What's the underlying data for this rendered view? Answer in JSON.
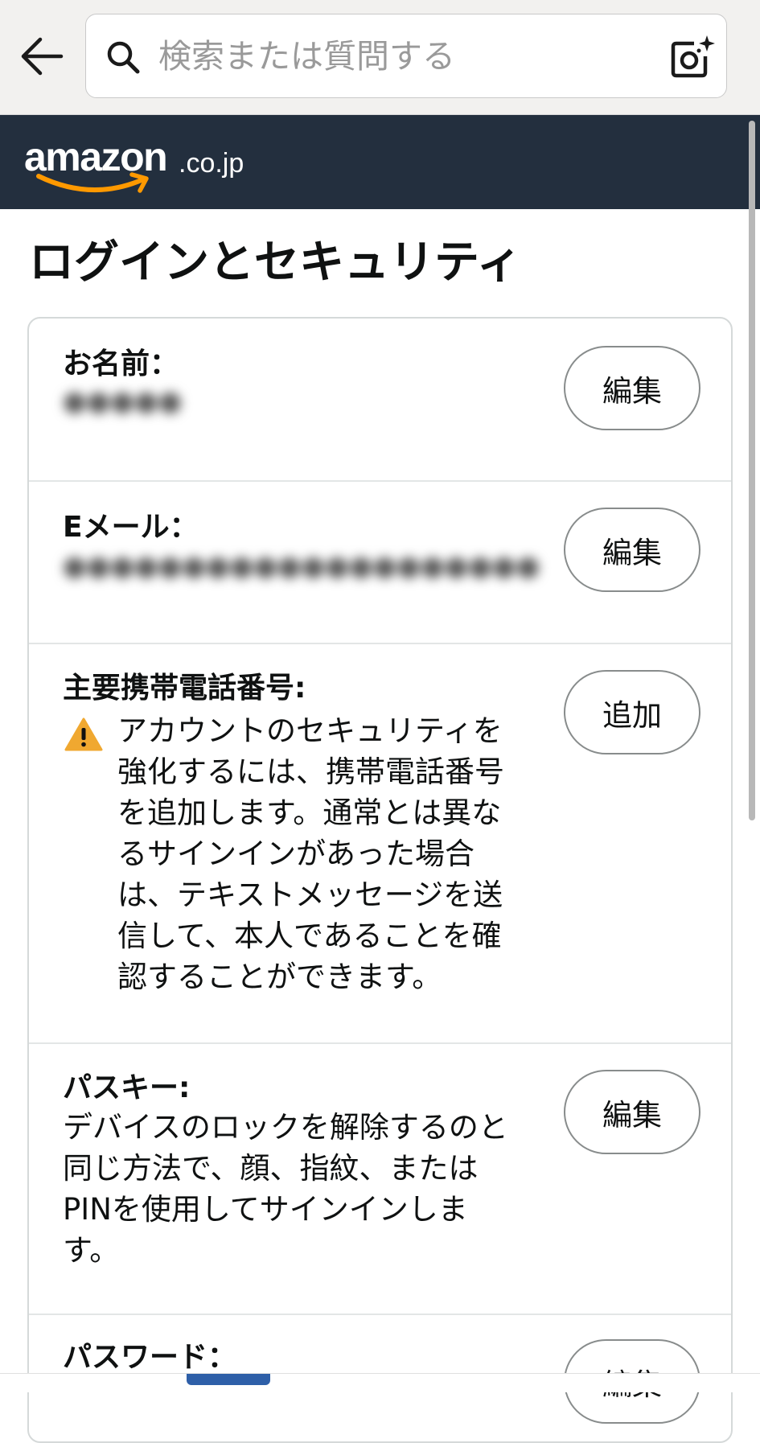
{
  "search": {
    "placeholder": "検索または質問する"
  },
  "header": {
    "logo_text": "amazon",
    "logo_suffix": ".co.jp"
  },
  "page": {
    "title": "ログインとセキュリティ"
  },
  "sections": {
    "name": {
      "label": "お名前：",
      "value": "●●●●●",
      "button": "編集"
    },
    "email": {
      "label": "Eメール：",
      "value": "●●●●●●●●●●●●●●●●●●●●",
      "button": "編集"
    },
    "phone": {
      "label": "主要携帯電話番号:",
      "button": "追加",
      "warning_lines": [
        "アカウントのセキュリティを",
        "強化するには、携帯電話番号",
        "を追加します。通常とは異な",
        "るサインインがあった場合",
        "は、テキストメッセージを送",
        "信して、本人であることを確",
        "認することができます。"
      ]
    },
    "passkey": {
      "label": "パスキー:",
      "button": "編集",
      "description_lines": [
        "デバイスのロックを解除するのと",
        "同じ方法で、顔、指紋、または",
        "PINを使用してサインインしま",
        "す。"
      ]
    },
    "password": {
      "label": "パスワード：",
      "button": "編集"
    }
  },
  "colors": {
    "amazon_header": "#232f3e",
    "amazon_smile": "#ff9900",
    "warning": "#f0a830"
  }
}
